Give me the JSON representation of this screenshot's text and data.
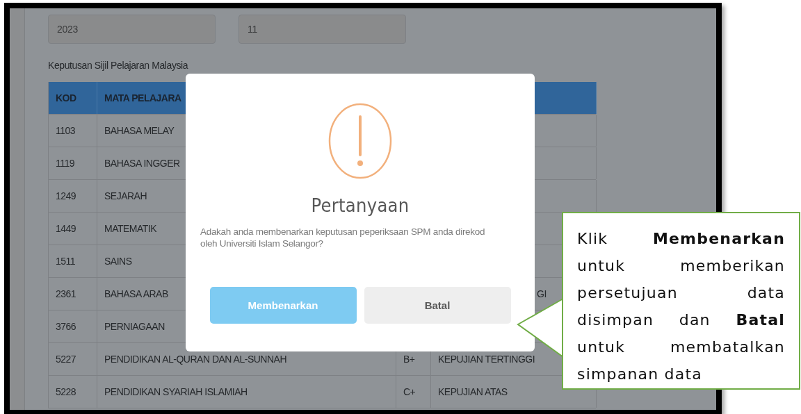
{
  "fields": [
    {
      "value": "2023"
    },
    {
      "value": "11"
    }
  ],
  "section_label": "Keputusan Sijil Pelajaran Malaysia",
  "table": {
    "columns": [
      "KOD",
      "MATA PELAJARA"
    ],
    "rows": [
      {
        "kod": "1103",
        "subject": "BAHASA MELAY"
      },
      {
        "kod": "1119",
        "subject": "BAHASA INGGER"
      },
      {
        "kod": "1249",
        "subject": "SEJARAH"
      },
      {
        "kod": "1449",
        "subject": "MATEMATIK"
      },
      {
        "kod": "1511",
        "subject": "SAINS"
      },
      {
        "kod": "2361",
        "subject": "BAHASA ARAB",
        "status_fragment": "GI"
      },
      {
        "kod": "3766",
        "subject": "PERNIAGAAN"
      },
      {
        "kod": "5227",
        "subject": "PENDIDIKAN AL-QURAN DAN AL-SUNNAH",
        "grade": "B+",
        "status": "KEPUJIAN TERTINGGI"
      },
      {
        "kod": "5228",
        "subject": "PENDIDIKAN SYARIAH ISLAMIAH",
        "grade": "C+",
        "status": "KEPUJIAN ATAS"
      }
    ]
  },
  "dialog": {
    "title": "Pertanyaan",
    "message": "Adakah anda membenarkan keputusan peperiksaan SPM anda direkod oleh Universiti Islam Selangor?",
    "buttons": [
      {
        "label": "Membenarkan",
        "kind": "confirm"
      },
      {
        "label": "Batal",
        "kind": "cancel"
      }
    ]
  },
  "callout": {
    "text": "Klik **Membenarkan** untuk memberikan persetujuan data disimpan dan **Batal** untuk membatalkan simpanan data"
  }
}
